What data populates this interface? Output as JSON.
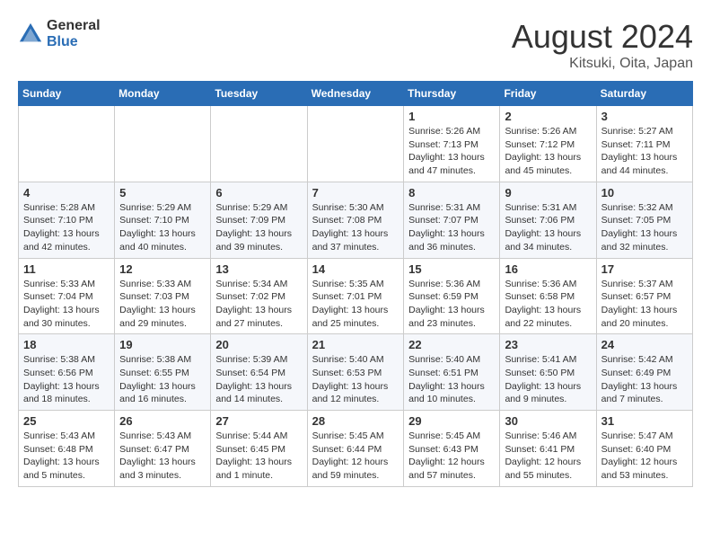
{
  "logo": {
    "general": "General",
    "blue": "Blue"
  },
  "header": {
    "month_year": "August 2024",
    "location": "Kitsuki, Oita, Japan"
  },
  "weekdays": [
    "Sunday",
    "Monday",
    "Tuesday",
    "Wednesday",
    "Thursday",
    "Friday",
    "Saturday"
  ],
  "weeks": [
    [
      {
        "day": "",
        "info": ""
      },
      {
        "day": "",
        "info": ""
      },
      {
        "day": "",
        "info": ""
      },
      {
        "day": "",
        "info": ""
      },
      {
        "day": "1",
        "info": "Sunrise: 5:26 AM\nSunset: 7:13 PM\nDaylight: 13 hours\nand 47 minutes."
      },
      {
        "day": "2",
        "info": "Sunrise: 5:26 AM\nSunset: 7:12 PM\nDaylight: 13 hours\nand 45 minutes."
      },
      {
        "day": "3",
        "info": "Sunrise: 5:27 AM\nSunset: 7:11 PM\nDaylight: 13 hours\nand 44 minutes."
      }
    ],
    [
      {
        "day": "4",
        "info": "Sunrise: 5:28 AM\nSunset: 7:10 PM\nDaylight: 13 hours\nand 42 minutes."
      },
      {
        "day": "5",
        "info": "Sunrise: 5:29 AM\nSunset: 7:10 PM\nDaylight: 13 hours\nand 40 minutes."
      },
      {
        "day": "6",
        "info": "Sunrise: 5:29 AM\nSunset: 7:09 PM\nDaylight: 13 hours\nand 39 minutes."
      },
      {
        "day": "7",
        "info": "Sunrise: 5:30 AM\nSunset: 7:08 PM\nDaylight: 13 hours\nand 37 minutes."
      },
      {
        "day": "8",
        "info": "Sunrise: 5:31 AM\nSunset: 7:07 PM\nDaylight: 13 hours\nand 36 minutes."
      },
      {
        "day": "9",
        "info": "Sunrise: 5:31 AM\nSunset: 7:06 PM\nDaylight: 13 hours\nand 34 minutes."
      },
      {
        "day": "10",
        "info": "Sunrise: 5:32 AM\nSunset: 7:05 PM\nDaylight: 13 hours\nand 32 minutes."
      }
    ],
    [
      {
        "day": "11",
        "info": "Sunrise: 5:33 AM\nSunset: 7:04 PM\nDaylight: 13 hours\nand 30 minutes."
      },
      {
        "day": "12",
        "info": "Sunrise: 5:33 AM\nSunset: 7:03 PM\nDaylight: 13 hours\nand 29 minutes."
      },
      {
        "day": "13",
        "info": "Sunrise: 5:34 AM\nSunset: 7:02 PM\nDaylight: 13 hours\nand 27 minutes."
      },
      {
        "day": "14",
        "info": "Sunrise: 5:35 AM\nSunset: 7:01 PM\nDaylight: 13 hours\nand 25 minutes."
      },
      {
        "day": "15",
        "info": "Sunrise: 5:36 AM\nSunset: 6:59 PM\nDaylight: 13 hours\nand 23 minutes."
      },
      {
        "day": "16",
        "info": "Sunrise: 5:36 AM\nSunset: 6:58 PM\nDaylight: 13 hours\nand 22 minutes."
      },
      {
        "day": "17",
        "info": "Sunrise: 5:37 AM\nSunset: 6:57 PM\nDaylight: 13 hours\nand 20 minutes."
      }
    ],
    [
      {
        "day": "18",
        "info": "Sunrise: 5:38 AM\nSunset: 6:56 PM\nDaylight: 13 hours\nand 18 minutes."
      },
      {
        "day": "19",
        "info": "Sunrise: 5:38 AM\nSunset: 6:55 PM\nDaylight: 13 hours\nand 16 minutes."
      },
      {
        "day": "20",
        "info": "Sunrise: 5:39 AM\nSunset: 6:54 PM\nDaylight: 13 hours\nand 14 minutes."
      },
      {
        "day": "21",
        "info": "Sunrise: 5:40 AM\nSunset: 6:53 PM\nDaylight: 13 hours\nand 12 minutes."
      },
      {
        "day": "22",
        "info": "Sunrise: 5:40 AM\nSunset: 6:51 PM\nDaylight: 13 hours\nand 10 minutes."
      },
      {
        "day": "23",
        "info": "Sunrise: 5:41 AM\nSunset: 6:50 PM\nDaylight: 13 hours\nand 9 minutes."
      },
      {
        "day": "24",
        "info": "Sunrise: 5:42 AM\nSunset: 6:49 PM\nDaylight: 13 hours\nand 7 minutes."
      }
    ],
    [
      {
        "day": "25",
        "info": "Sunrise: 5:43 AM\nSunset: 6:48 PM\nDaylight: 13 hours\nand 5 minutes."
      },
      {
        "day": "26",
        "info": "Sunrise: 5:43 AM\nSunset: 6:47 PM\nDaylight: 13 hours\nand 3 minutes."
      },
      {
        "day": "27",
        "info": "Sunrise: 5:44 AM\nSunset: 6:45 PM\nDaylight: 13 hours\nand 1 minute."
      },
      {
        "day": "28",
        "info": "Sunrise: 5:45 AM\nSunset: 6:44 PM\nDaylight: 12 hours\nand 59 minutes."
      },
      {
        "day": "29",
        "info": "Sunrise: 5:45 AM\nSunset: 6:43 PM\nDaylight: 12 hours\nand 57 minutes."
      },
      {
        "day": "30",
        "info": "Sunrise: 5:46 AM\nSunset: 6:41 PM\nDaylight: 12 hours\nand 55 minutes."
      },
      {
        "day": "31",
        "info": "Sunrise: 5:47 AM\nSunset: 6:40 PM\nDaylight: 12 hours\nand 53 minutes."
      }
    ]
  ]
}
